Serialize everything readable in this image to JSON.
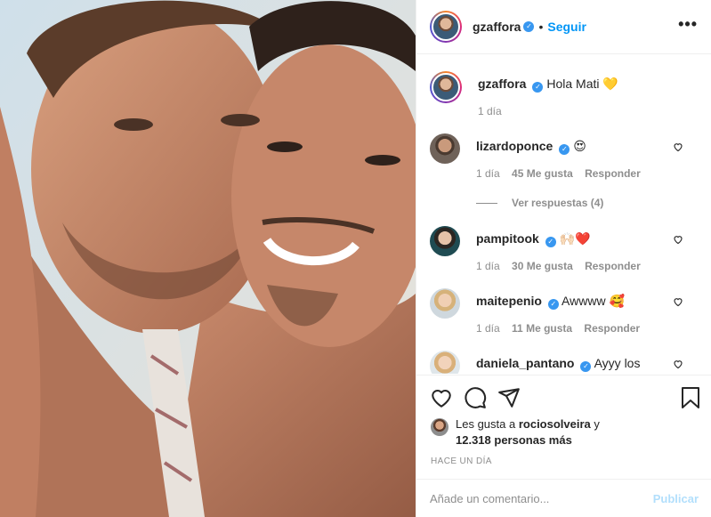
{
  "post": {
    "author": "gzaffora",
    "separator": "•",
    "follow_label": "Seguir",
    "more_label": "•••",
    "image_alt": "photo"
  },
  "comments": [
    {
      "user": "gzaffora",
      "text": "Hola Mati 💛",
      "time": "1 día",
      "likes": "",
      "reply": "",
      "is_caption": true
    },
    {
      "user": "lizardoponce",
      "text": "😍",
      "time": "1 día",
      "likes": "45 Me gusta",
      "reply": "Responder"
    },
    {
      "user": "pampitook",
      "text": "🙌🏻❤️",
      "time": "1 día",
      "likes": "30 Me gusta",
      "reply": "Responder"
    },
    {
      "user": "maitepenio",
      "text": "Awwww 🥰",
      "time": "1 día",
      "likes": "11 Me gusta",
      "reply": "Responder"
    },
    {
      "user": "daniela_pantano",
      "text": "Ayyy los",
      "time": "",
      "likes": "",
      "reply": ""
    }
  ],
  "view_replies": "Ver respuestas (4)",
  "likes": {
    "prefix": "Les gusta a",
    "user": "rociosolveira",
    "mid": "y",
    "count": "12.318 personas más"
  },
  "timestamp": "HACE UN DÍA",
  "add_comment": {
    "placeholder": "Añade un comentario...",
    "publish_label": "Publicar"
  },
  "colors": {
    "accent": "#0095f6",
    "publish_disabled": "#b2dffc",
    "muted": "#8e8e8e",
    "verified": "#3897f0"
  },
  "icons": [
    "heart-icon",
    "comment-icon",
    "share-icon",
    "bookmark-icon",
    "more-options-icon",
    "verified-badge-icon"
  ]
}
